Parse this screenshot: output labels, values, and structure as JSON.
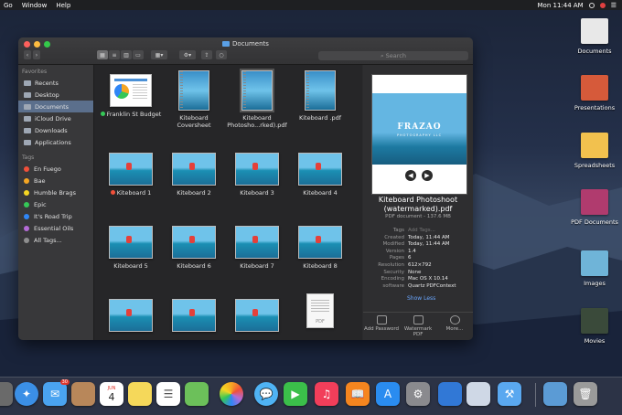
{
  "menubar": {
    "left": [
      "Go",
      "Window",
      "Help"
    ],
    "clock": "Mon 11:44 AM"
  },
  "desktop_icons": [
    {
      "label": "Documents",
      "color": "#e8e8e8"
    },
    {
      "label": "Presentations",
      "color": "#d65a3a"
    },
    {
      "label": "Spreadsheets",
      "color": "#f2c14e"
    },
    {
      "label": "PDF Documents",
      "color": "#b03b6e"
    },
    {
      "label": "Images",
      "color": "#6fb4d8"
    },
    {
      "label": "Movies",
      "color": "#3a4a3a"
    }
  ],
  "window": {
    "title": "Documents",
    "search_placeholder": "Search"
  },
  "sidebar": {
    "favorites_header": "Favorites",
    "favorites": [
      "Recents",
      "Desktop",
      "Documents",
      "iCloud Drive",
      "Downloads",
      "Applications"
    ],
    "tags_header": "Tags",
    "tags": [
      {
        "label": "En Fuego",
        "color": "#f0503a"
      },
      {
        "label": "Bae",
        "color": "#f5a623"
      },
      {
        "label": "Humble Brags",
        "color": "#f5d623"
      },
      {
        "label": "Epic",
        "color": "#35c757"
      },
      {
        "label": "It's Road Trip",
        "color": "#2f86f6"
      },
      {
        "label": "Essential Oils",
        "color": "#b46bd6"
      },
      {
        "label": "All Tags...",
        "color": "#8e8e8e"
      }
    ]
  },
  "files": [
    {
      "name": "Franklin St Budget",
      "tag": "green",
      "kind": "doc"
    },
    {
      "name": "Kiteboard Coversheet",
      "tag": "",
      "kind": "book"
    },
    {
      "name": "Kiteboard Photosho...rked).pdf",
      "tag": "",
      "kind": "book",
      "selected": true
    },
    {
      "name": "Kiteboard .pdf",
      "tag": "",
      "kind": "book"
    },
    {
      "name": "Kiteboard 1",
      "tag": "red",
      "kind": "photo"
    },
    {
      "name": "Kiteboard 2",
      "tag": "",
      "kind": "photo"
    },
    {
      "name": "Kiteboard 3",
      "tag": "",
      "kind": "photo"
    },
    {
      "name": "Kiteboard 4",
      "tag": "",
      "kind": "photo"
    },
    {
      "name": "Kiteboard 5",
      "tag": "",
      "kind": "photo"
    },
    {
      "name": "Kiteboard 6",
      "tag": "",
      "kind": "photo"
    },
    {
      "name": "Kiteboard 7",
      "tag": "",
      "kind": "photo"
    },
    {
      "name": "Kiteboard 8",
      "tag": "",
      "kind": "photo"
    },
    {
      "name": "",
      "tag": "",
      "kind": "photo"
    },
    {
      "name": "",
      "tag": "",
      "kind": "photo"
    },
    {
      "name": "",
      "tag": "",
      "kind": "photo"
    },
    {
      "name": "",
      "tag": "",
      "kind": "pdf"
    }
  ],
  "pdf_thumb_label": "PDF",
  "preview": {
    "brand": "FRAZAO",
    "brand_sub": "PHOTOGRAPHY LLC",
    "title": "Kiteboard  Photoshoot (watermarked).pdf",
    "kind": "PDF document - 137.6 MB",
    "meta": [
      {
        "k": "Tags",
        "v": "Add Tags...",
        "placeholder": true
      },
      {
        "k": "Created",
        "v": "Today, 11:44 AM"
      },
      {
        "k": "Modified",
        "v": "Today, 11:44 AM"
      },
      {
        "k": "Version",
        "v": "1.4"
      },
      {
        "k": "Pages",
        "v": "6"
      },
      {
        "k": "Resolution",
        "v": "612×792"
      },
      {
        "k": "Security",
        "v": "None"
      },
      {
        "k": "Encoding",
        "v": "Mac OS X 10.14"
      },
      {
        "k": "software",
        "v": "Quartz PDFContext"
      }
    ],
    "show_less": "Show Less",
    "actions": [
      "Add Password",
      "Watermark PDF",
      "More..."
    ]
  },
  "dock": {
    "calendar_month": "JUN",
    "calendar_day": "4",
    "mail_badge": "30",
    "apps": [
      {
        "name": "Safari",
        "color": "#3b8fe6"
      },
      {
        "name": "Mail",
        "color": "#4aa3f0"
      },
      {
        "name": "Notefile",
        "color": "#b8875a"
      },
      {
        "name": "Calendar",
        "color": "#ffffff"
      },
      {
        "name": "Notes",
        "color": "#f5d85a"
      },
      {
        "name": "Reminders",
        "color": "#ffffff"
      },
      {
        "name": "Maps",
        "color": "#6cc05a"
      },
      {
        "name": "Photos",
        "color": "#f2f2f2"
      },
      {
        "name": "Messages",
        "color": "#4fb3f5"
      },
      {
        "name": "FaceTime",
        "color": "#3bbf4a"
      },
      {
        "name": "Music",
        "color": "#f23e5a"
      },
      {
        "name": "Books",
        "color": "#f5851f"
      },
      {
        "name": "App Store",
        "color": "#2a8cf0"
      },
      {
        "name": "System Preferences",
        "color": "#8a8a8e"
      },
      {
        "name": "Keynote",
        "color": "#3178d6"
      },
      {
        "name": "Preview",
        "color": "#cfd8e6"
      },
      {
        "name": "Xcode",
        "color": "#5aa8f0"
      },
      {
        "name": "Downloads Folder",
        "color": "#5b9bd5"
      },
      {
        "name": "Trash",
        "color": "#9a9a9a"
      }
    ]
  }
}
